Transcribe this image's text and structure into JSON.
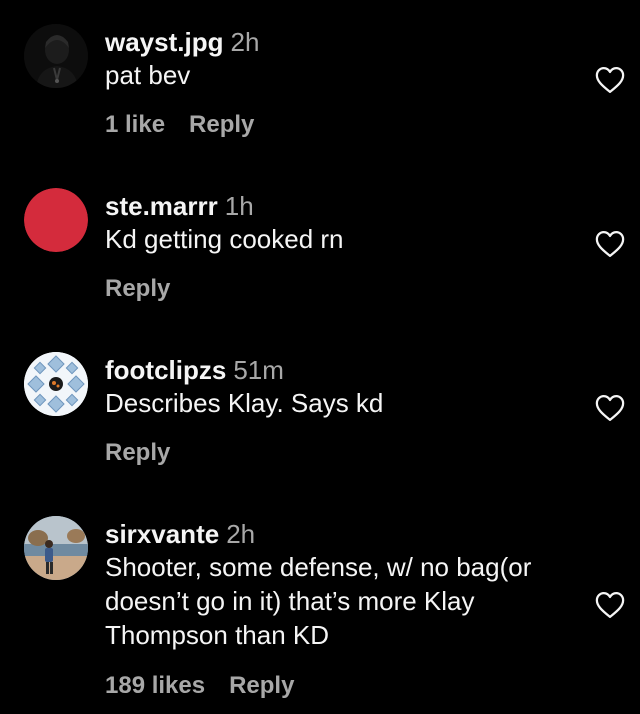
{
  "comments": [
    {
      "username": "wayst.jpg",
      "time": "2h",
      "text": "pat bev",
      "likes": "1 like",
      "reply": "Reply",
      "avatar_icon": "dark-figure-avatar"
    },
    {
      "username": "ste.marrr",
      "time": "1h",
      "text": "Kd getting cooked rn",
      "likes": "",
      "reply": "Reply",
      "avatar_icon": "red-circle-avatar",
      "avatar_color": "#d42b3c"
    },
    {
      "username": "footclipzs",
      "time": "51m",
      "text": "Describes Klay. Says kd",
      "likes": "",
      "reply": "Reply",
      "avatar_icon": "soccer-ball-avatar"
    },
    {
      "username": "sirxvante",
      "time": "2h",
      "text": "Shooter, some defense, w/ no bag(or doesn’t go in it) that’s more Klay Thompson than KD",
      "likes": "189 likes",
      "reply": "Reply",
      "avatar_icon": "beach-photo-avatar"
    }
  ],
  "like_icon": "heart-outline-icon",
  "colors": {
    "background": "#000000",
    "primary_text": "#f5f5f5",
    "secondary_text": "#a8a8a8"
  }
}
